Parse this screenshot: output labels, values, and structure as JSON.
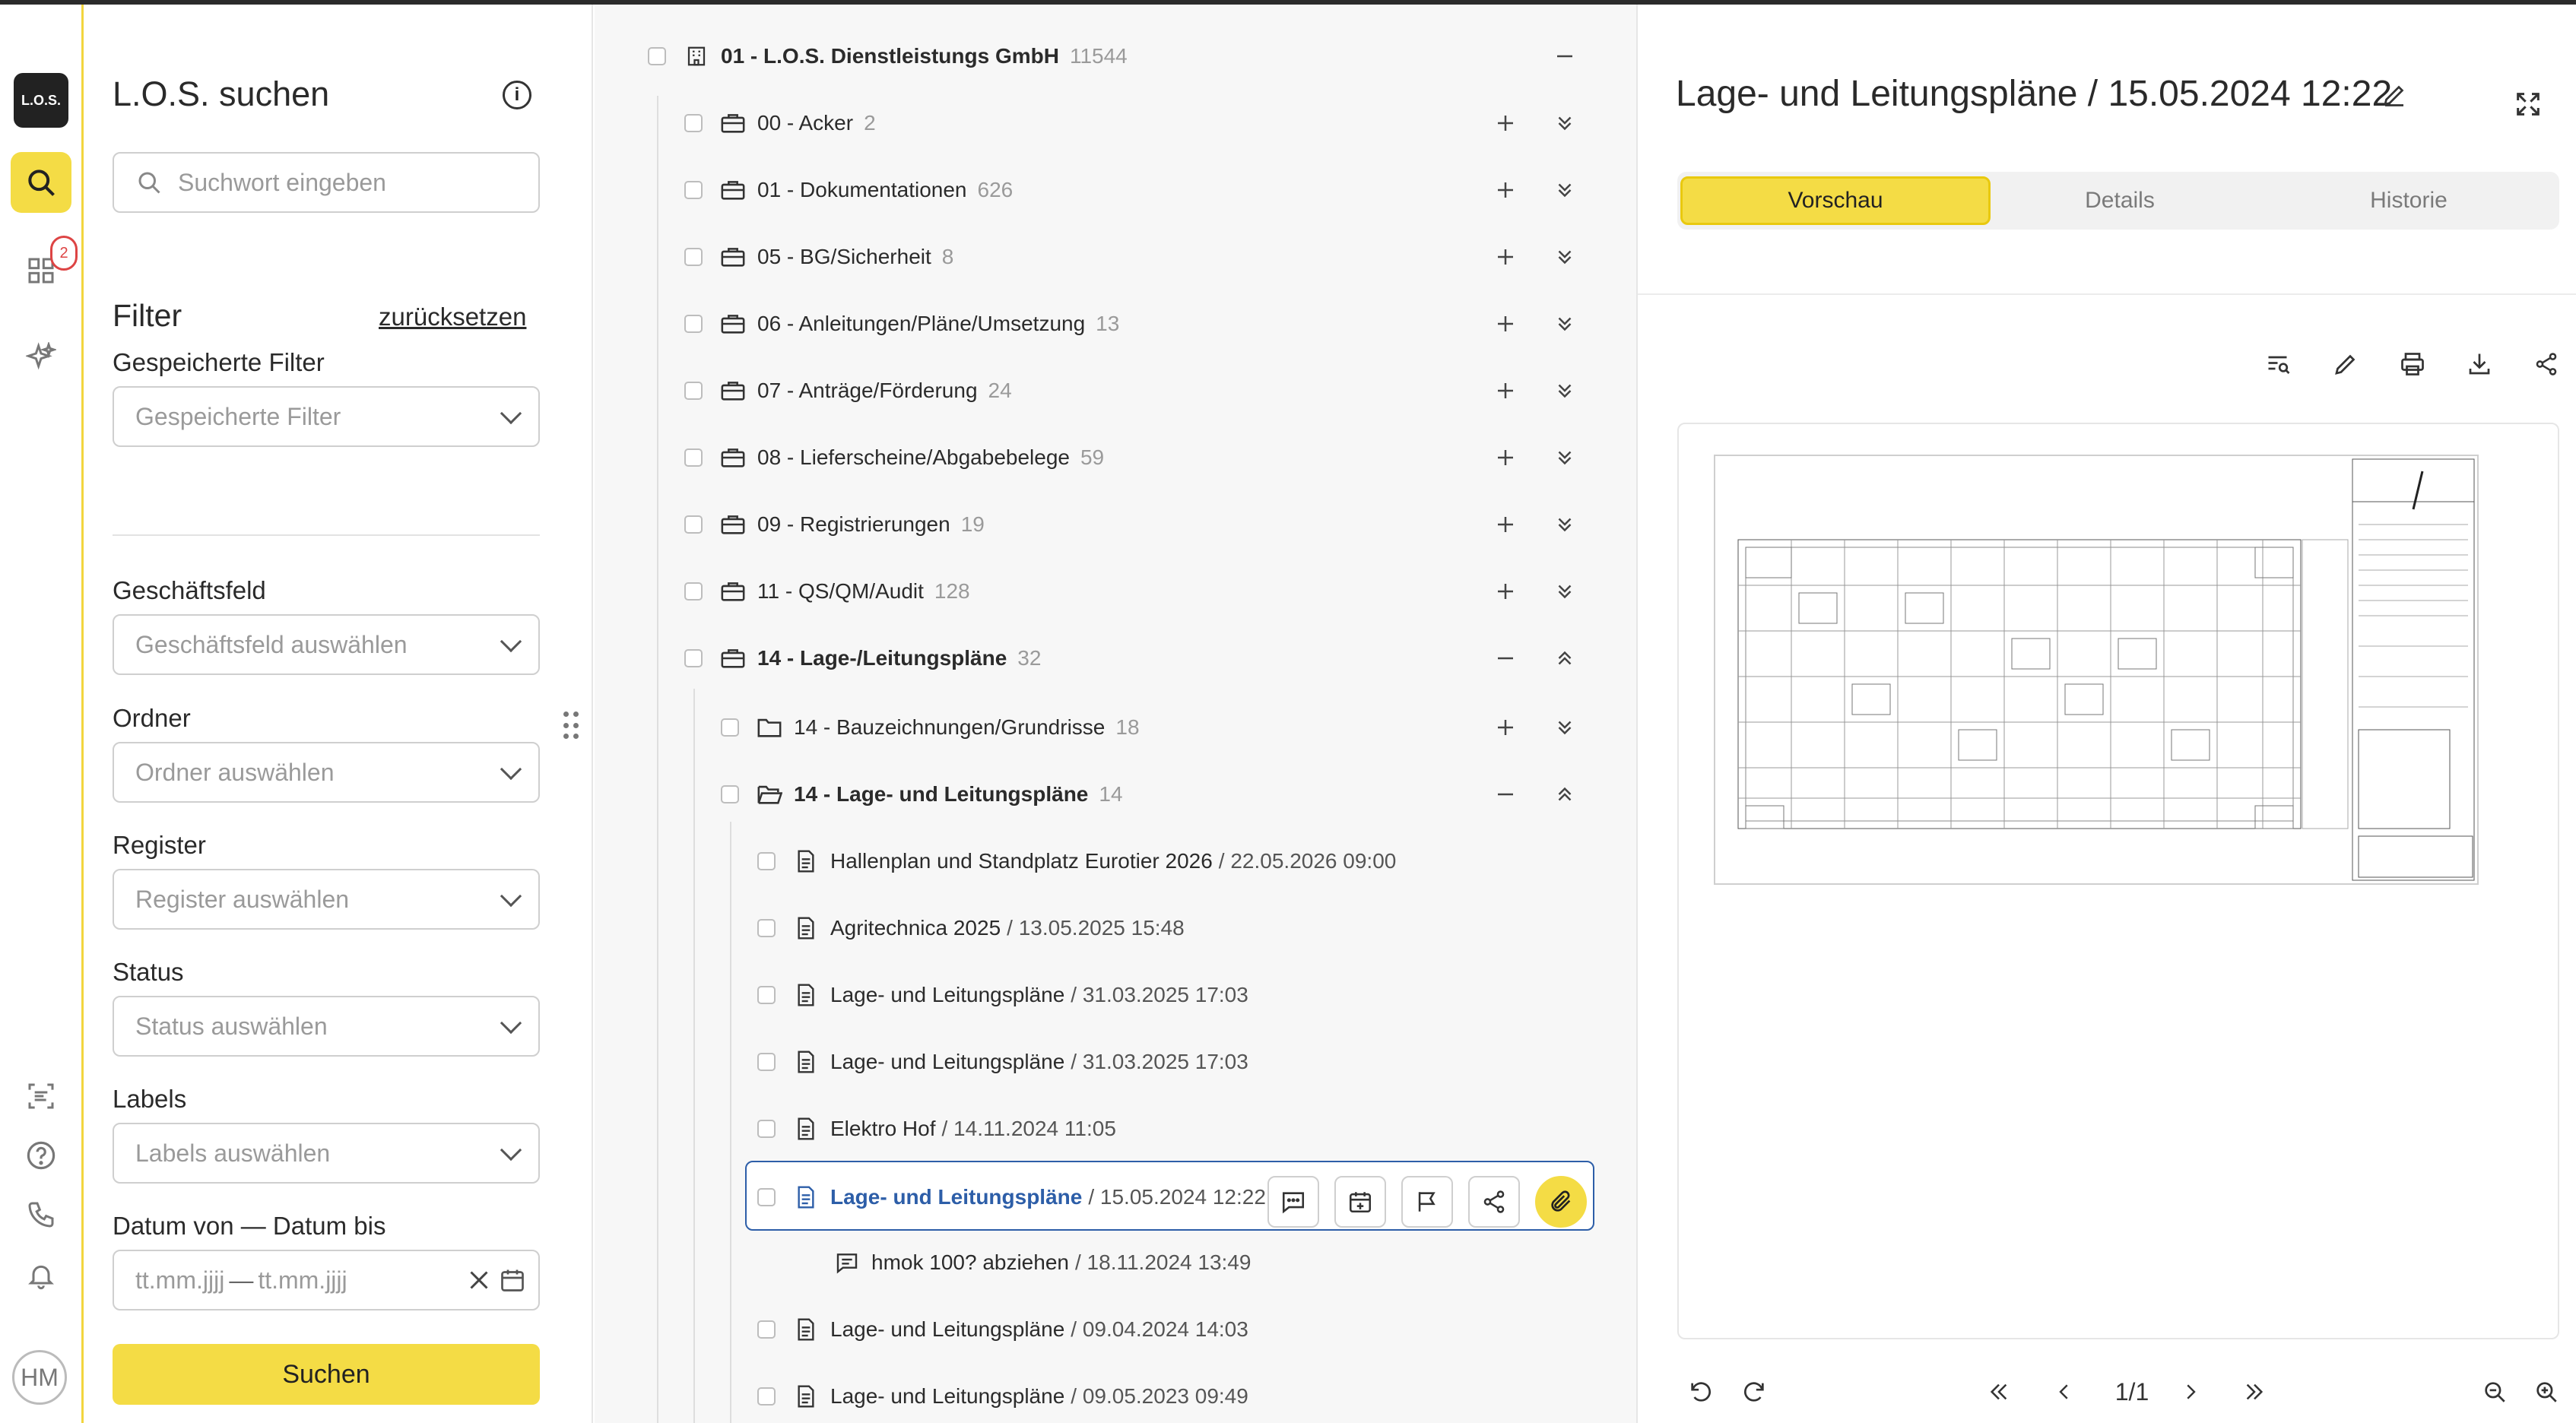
{
  "rail": {
    "logo": "L.O.S.",
    "notifications_badge": "2",
    "avatar": "HM"
  },
  "search": {
    "title": "L.O.S. suchen",
    "keyword_placeholder": "Suchwort eingeben",
    "filter_heading": "Filter",
    "reset_label": "zurücksetzen",
    "saved_filters_label": "Gespeicherte Filter",
    "saved_filters_placeholder": "Gespeicherte Filter",
    "business_label": "Geschäftsfeld",
    "business_placeholder": "Geschäftsfeld auswählen",
    "folder_label": "Ordner",
    "folder_placeholder": "Ordner auswählen",
    "register_label": "Register",
    "register_placeholder": "Register auswählen",
    "status_label": "Status",
    "status_placeholder": "Status auswählen",
    "labels_label": "Labels",
    "labels_placeholder": "Labels auswählen",
    "date_label": "Datum von — Datum bis",
    "date_from_placeholder": "tt.mm.jjjj",
    "date_sep": "—",
    "date_to_placeholder": "tt.mm.jjjj",
    "search_button": "Suchen"
  },
  "tree": {
    "root": {
      "name": "01 - L.O.S. Dienstleistungs GmbH",
      "count": "11544"
    },
    "registers": [
      {
        "name": "00 - Acker",
        "count": "2"
      },
      {
        "name": "01 - Dokumentationen",
        "count": "626"
      },
      {
        "name": "05 - BG/Sicherheit",
        "count": "8"
      },
      {
        "name": "06 - Anleitungen/Pläne/Umsetzung",
        "count": "13"
      },
      {
        "name": "07 - Anträge/Förderung",
        "count": "24"
      },
      {
        "name": "08 - Lieferscheine/Abgabebelege",
        "count": "59"
      },
      {
        "name": "09 - Registrierungen",
        "count": "19"
      },
      {
        "name": "11 - QS/QM/Audit",
        "count": "128"
      },
      {
        "name": "14 - Lage-/Leitungspläne",
        "count": "32"
      }
    ],
    "folders": [
      {
        "name": "14 - Bauzeichnungen/Grundrisse",
        "count": "18"
      },
      {
        "name": "14 - Lage- und Leitungspläne",
        "count": "14"
      }
    ],
    "documents": [
      {
        "name": "Hallenplan und Standplatz Eurotier 2026",
        "date": "/ 22.05.2026 09:00"
      },
      {
        "name": "Agritechnica 2025",
        "date": "/ 13.05.2025 15:48"
      },
      {
        "name": "Lage- und Leitungspläne",
        "date": "/ 31.03.2025 17:03"
      },
      {
        "name": "Lage- und Leitungspläne",
        "date": "/ 31.03.2025 17:03"
      },
      {
        "name": "Elektro Hof",
        "date": "/ 14.11.2024 11:05"
      }
    ],
    "selected": {
      "name": "Lage- und Leitungspläne",
      "date": "/ 15.05.2024 12:22"
    },
    "comment": {
      "name": "hmok 100? abziehen",
      "date": "/ 18.11.2024 13:49"
    },
    "documents_after": [
      {
        "name": "Lage- und Leitungspläne",
        "date": "/ 09.04.2024 14:03"
      },
      {
        "name": "Lage- und Leitungspläne",
        "date": "/ 09.05.2023 09:49"
      }
    ]
  },
  "preview": {
    "title": "Lage- und Leitungspläne / 15.05.2024 12:22",
    "tabs": [
      "Vorschau",
      "Details",
      "Historie"
    ],
    "page_indicator": "1/1",
    "accent_color": "#f4dc45",
    "link_color": "#2d5ea8"
  }
}
